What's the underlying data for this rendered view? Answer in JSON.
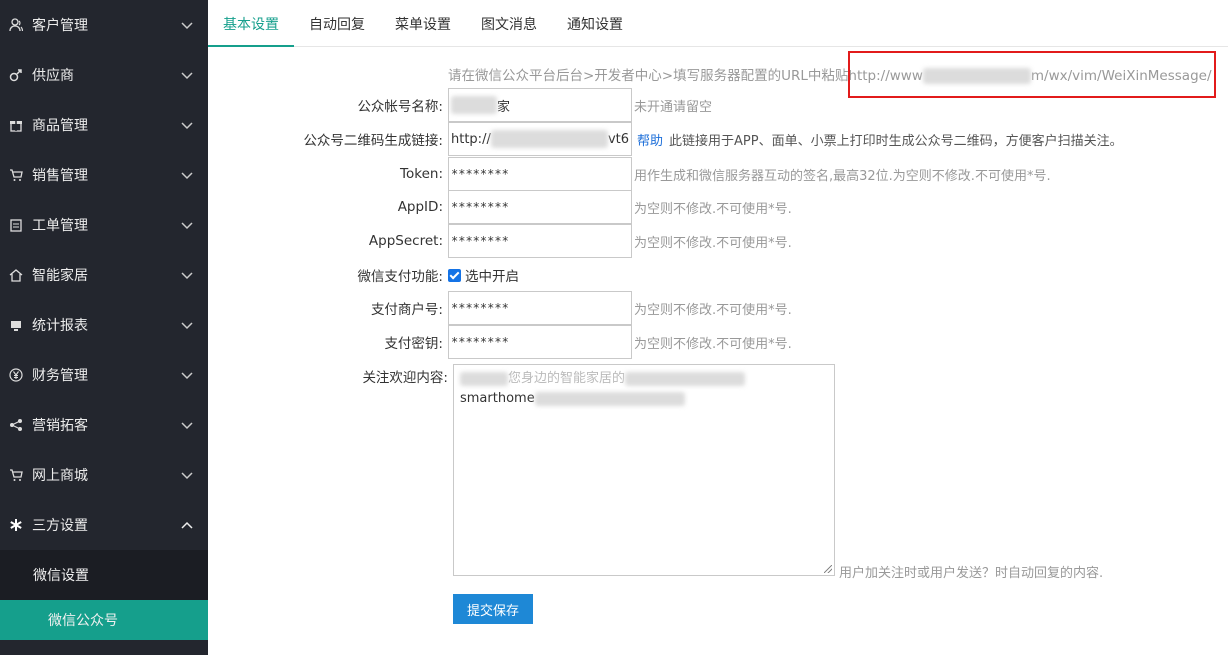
{
  "sidebar": {
    "items": [
      {
        "label": "客户管理",
        "icon": "users-icon"
      },
      {
        "label": "供应商",
        "icon": "male-icon"
      },
      {
        "label": "商品管理",
        "icon": "gift-icon"
      },
      {
        "label": "销售管理",
        "icon": "cart-icon"
      },
      {
        "label": "工单管理",
        "icon": "clipboard-icon"
      },
      {
        "label": "智能家居",
        "icon": "home-icon"
      },
      {
        "label": "统计报表",
        "icon": "monitor-icon"
      },
      {
        "label": "财务管理",
        "icon": "yen-icon"
      },
      {
        "label": "营销拓客",
        "icon": "share-icon"
      },
      {
        "label": "网上商城",
        "icon": "cart-icon"
      },
      {
        "label": "三方设置",
        "icon": "snowflake-icon"
      }
    ],
    "sub_group": "微信设置",
    "sub_active": "微信公众号"
  },
  "tabs": [
    "基本设置",
    "自动回复",
    "菜单设置",
    "图文消息",
    "通知设置"
  ],
  "active_tab": "基本设置",
  "notice": {
    "prefix": "请在微信公众平台后台>开发者中心>填写服务器配置的URL中粘贴",
    "url_start": "http://www",
    "url_end": "m/wx/vim/WeiXinMessage/"
  },
  "form": {
    "account_name": {
      "label": "公众帐号名称:",
      "value": "家",
      "hint": "未开通请留空"
    },
    "qr_link": {
      "label": "公众号二维码生成链接:",
      "value": "http://",
      "value_tail": "vt6",
      "help": "帮助",
      "hint": "此链接用于APP、面单、小票上打印时生成公众号二维码，方便客户扫描关注。"
    },
    "token": {
      "label": "Token:",
      "value": "********",
      "hint": "用作生成和微信服务器互动的签名,最高32位.为空则不修改.不可使用*号."
    },
    "appid": {
      "label": "AppID:",
      "value": "********",
      "hint": "为空则不修改.不可使用*号."
    },
    "appsecret": {
      "label": "AppSecret:",
      "value": "********",
      "hint": "为空则不修改.不可使用*号."
    },
    "pay": {
      "label": "微信支付功能:",
      "checkbox": "选中开启"
    },
    "mch_id": {
      "label": "支付商户号:",
      "value": "********",
      "hint": "为空则不修改.不可使用*号."
    },
    "pay_key": {
      "label": "支付密钥:",
      "value": "********",
      "hint": "为空则不修改.不可使用*号."
    },
    "welcome": {
      "label": "关注欢迎内容:",
      "line1": "您身边的智能家居的",
      "line2": "smarthome",
      "hint": "用户加关注时或用户发送？时自动回复的内容."
    },
    "submit": "提交保存"
  }
}
